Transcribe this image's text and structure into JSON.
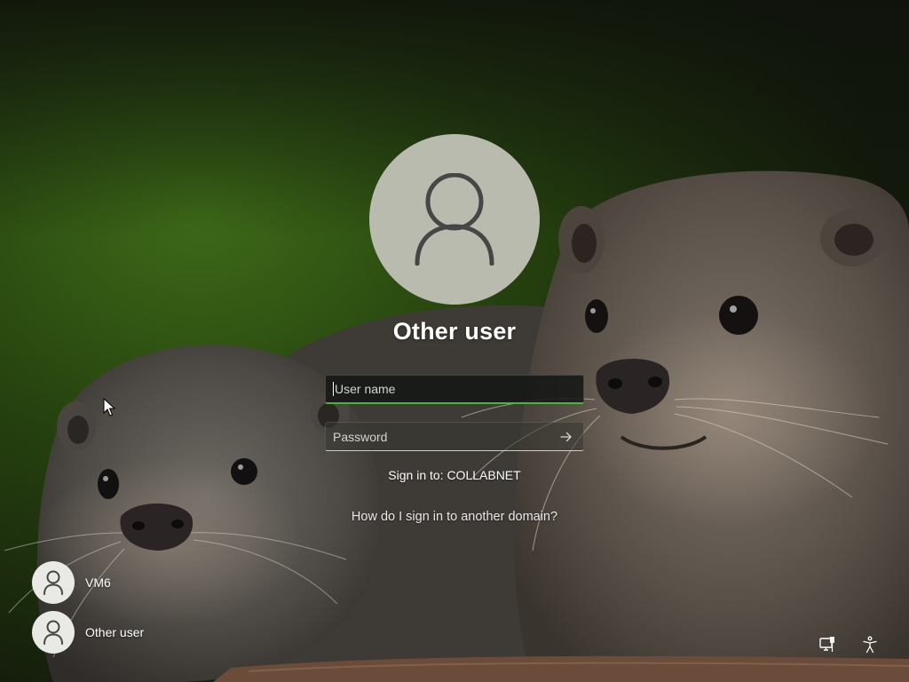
{
  "screen": {
    "type": "windows-sign-in",
    "wallpaper_subject": "two otters on dark green background"
  },
  "account": {
    "title": "Other user",
    "avatar_icon": "person-icon"
  },
  "form": {
    "username_placeholder": "User name",
    "username_value": "",
    "password_placeholder": "Password",
    "password_value": "",
    "submit_icon": "arrow-right-icon",
    "focus_accent": "#4bb33b"
  },
  "sign_in_to": "Sign in to: COLLABNET",
  "domain_help_link": "How do I sign in to another domain?",
  "user_list": [
    {
      "label": "VM6",
      "icon": "person-icon"
    },
    {
      "label": "Other user",
      "icon": "person-icon"
    }
  ],
  "corner_buttons": [
    {
      "icon": "network-icon"
    },
    {
      "icon": "accessibility-icon"
    }
  ]
}
